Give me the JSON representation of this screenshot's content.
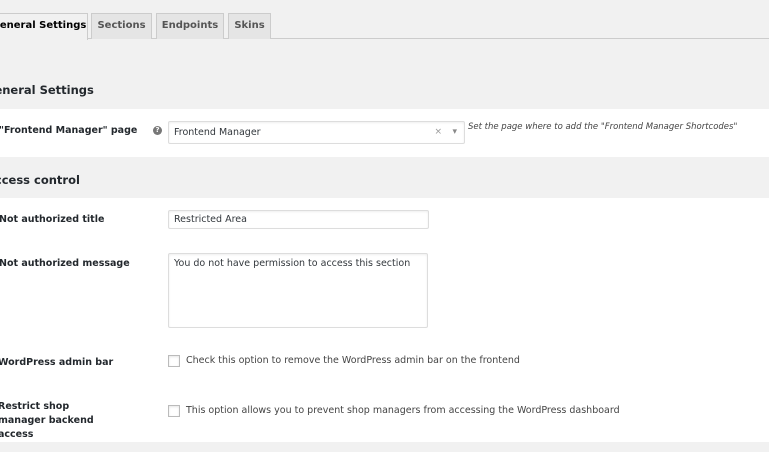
{
  "tabs": [
    {
      "label": "General Settings",
      "active": true
    },
    {
      "label": "Sections"
    },
    {
      "label": "Endpoints"
    },
    {
      "label": "Skins"
    }
  ],
  "general": {
    "heading": "General Settings",
    "page_label": "\"Frontend Manager\" page",
    "help_icon": "question-circle-icon",
    "page_value": "Frontend Manager",
    "clear": "×",
    "arrow": "▾",
    "page_desc": "Set the page where to add the \"Frontend Manager Shortcodes\""
  },
  "access": {
    "heading": "Access control",
    "title_label": "Not authorized title",
    "title_value": "Restricted Area",
    "message_label": "Not authorized message",
    "message_value": "You do not have permission to access this section",
    "adminbar_label": "WordPress admin bar",
    "adminbar_text": "Check this option to remove the WordPress admin bar on the frontend",
    "adminbar_checked": false,
    "restrict_label": "Restrict shop manager backend access",
    "restrict_text": "This option allows you to prevent shop managers from accessing the WordPress dashboard",
    "restrict_checked": false
  }
}
